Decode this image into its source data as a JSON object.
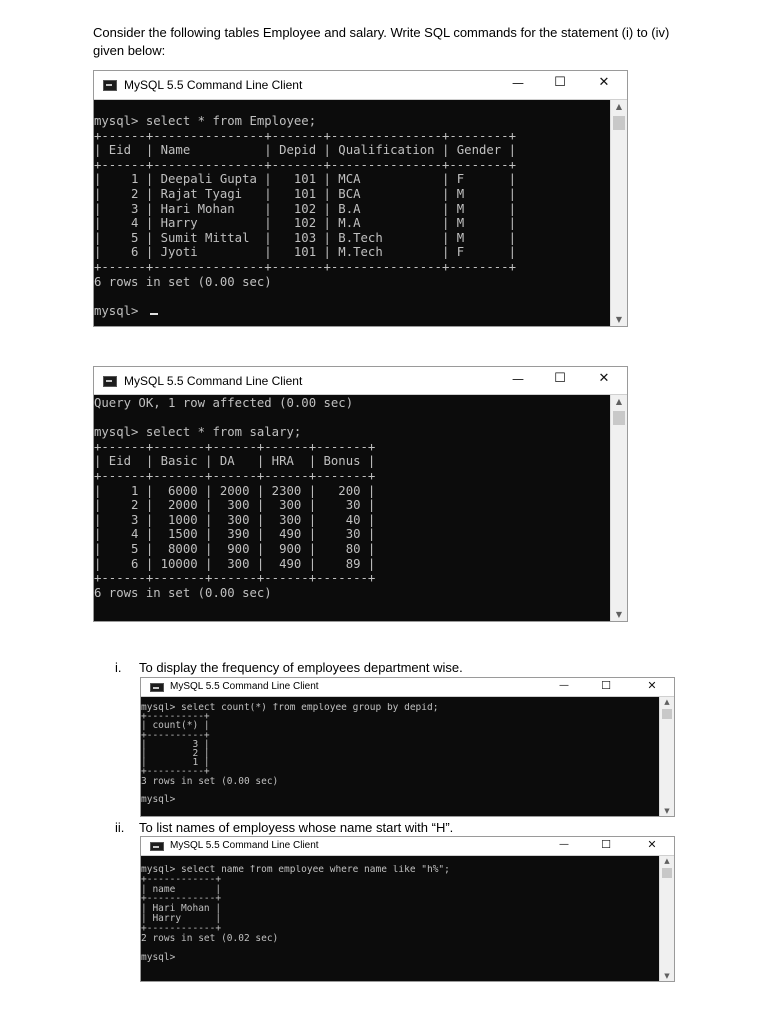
{
  "question": "Consider the following tables Employee and salary. Write SQL commands for the statement (i) to (iv) given below:",
  "window_title": "MySQL 5.5 Command Line Client",
  "buttons": {
    "minimize": "—",
    "maximize": "☐",
    "close": "✕"
  },
  "icons": {
    "app": "mysql-app-icon",
    "scroll_up": "▲",
    "scroll_down": "▼"
  },
  "colors": {
    "terminal_bg": "#0c0c0c",
    "terminal_fg": "#c0c0c0",
    "titlebar": "#ffffff"
  },
  "windows": [
    {
      "lines": [
        "mysql> select * from Employee;",
        "+------+---------------+-------+---------------+--------+",
        "| Eid  | Name          | Depid | Qualification | Gender |",
        "+------+---------------+-------+---------------+--------+",
        "|    1 | Deepali Gupta |   101 | MCA           | F      |",
        "|    2 | Rajat Tyagi   |   101 | BCA           | M      |",
        "|    3 | Hari Mohan    |   102 | B.A           | M      |",
        "|    4 | Harry         |   102 | M.A           | M      |",
        "|    5 | Sumit Mittal  |   103 | B.Tech        | M      |",
        "|    6 | Jyoti         |   101 | M.Tech        | F      |",
        "+------+---------------+-------+---------------+--------+",
        "6 rows in set (0.00 sec)",
        "",
        "mysql> "
      ]
    },
    {
      "lines": [
        "Query OK, 1 row affected (0.00 sec)",
        "",
        "mysql> select * from salary;",
        "+------+-------+------+------+-------+",
        "| Eid  | Basic | DA   | HRA  | Bonus |",
        "+------+-------+------+------+-------+",
        "|    1 |  6000 | 2000 | 2300 |   200 |",
        "|    2 |  2000 |  300 |  300 |    30 |",
        "|    3 |  1000 |  300 |  300 |    40 |",
        "|    4 |  1500 |  390 |  490 |    30 |",
        "|    5 |  8000 |  900 |  900 |    80 |",
        "|    6 | 10000 |  300 |  490 |    89 |",
        "+------+-------+------+------+-------+",
        "6 rows in set (0.00 sec)"
      ]
    },
    {
      "lines": [
        "mysql> select count(*) from employee group by depid;",
        "+----------+",
        "| count(*) |",
        "+----------+",
        "|        3 |",
        "|        2 |",
        "|        1 |",
        "+----------+",
        "3 rows in set (0.00 sec)",
        "",
        "mysql>"
      ]
    },
    {
      "lines": [
        "mysql> select name from employee where name like \"h%\";",
        "+------------+",
        "| name       |",
        "+------------+",
        "| Hari Mohan |",
        "| Harry      |",
        "+------------+",
        "2 rows in set (0.02 sec)",
        "",
        "mysql>"
      ]
    }
  ],
  "questions": [
    {
      "num": "i.",
      "text": "To display the frequency of employees department wise."
    },
    {
      "num": "ii.",
      "text": "To list names of employess whose name start with “H”."
    }
  ]
}
